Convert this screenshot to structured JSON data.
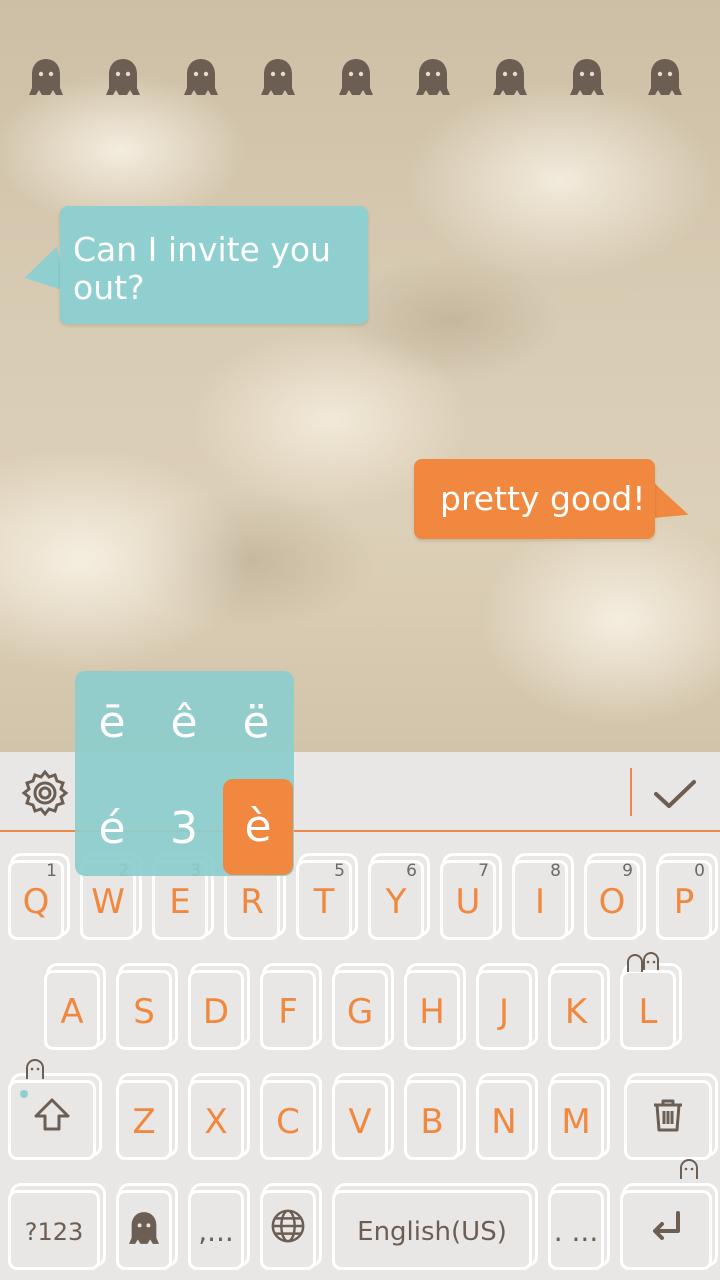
{
  "chat": {
    "incoming": "Can I invite you out?",
    "outgoing": "pretty good!"
  },
  "ghost_icon_count": 9,
  "accent_popup": {
    "row1": [
      "ē",
      "ê",
      "ë"
    ],
    "row2": [
      "é",
      "3",
      "è"
    ],
    "selected": "è"
  },
  "keyboard": {
    "row1": [
      {
        "label": "Q",
        "hint": "1"
      },
      {
        "label": "W",
        "hint": "2"
      },
      {
        "label": "E",
        "hint": "3"
      },
      {
        "label": "R",
        "hint": "4"
      },
      {
        "label": "T",
        "hint": "5"
      },
      {
        "label": "Y",
        "hint": "6"
      },
      {
        "label": "U",
        "hint": "7"
      },
      {
        "label": "I",
        "hint": "8"
      },
      {
        "label": "O",
        "hint": "9"
      },
      {
        "label": "P",
        "hint": "0"
      }
    ],
    "row2": [
      "A",
      "S",
      "D",
      "F",
      "G",
      "H",
      "J",
      "K",
      "L"
    ],
    "row3": [
      "Z",
      "X",
      "C",
      "V",
      "B",
      "N",
      "M"
    ],
    "symbols_key": "?123",
    "comma_key": ",...",
    "space_label": "English(US)",
    "period_key": ". ..."
  },
  "colors": {
    "accent_orange": "#f0893f",
    "accent_teal": "#8fcfcf",
    "icon_brown": "#6d5e53",
    "keyboard_bg": "#e8e7e6"
  },
  "icons": [
    "settings-icon",
    "check-icon",
    "shift-icon",
    "delete-icon",
    "ghost-icon",
    "globe-icon",
    "enter-icon"
  ]
}
